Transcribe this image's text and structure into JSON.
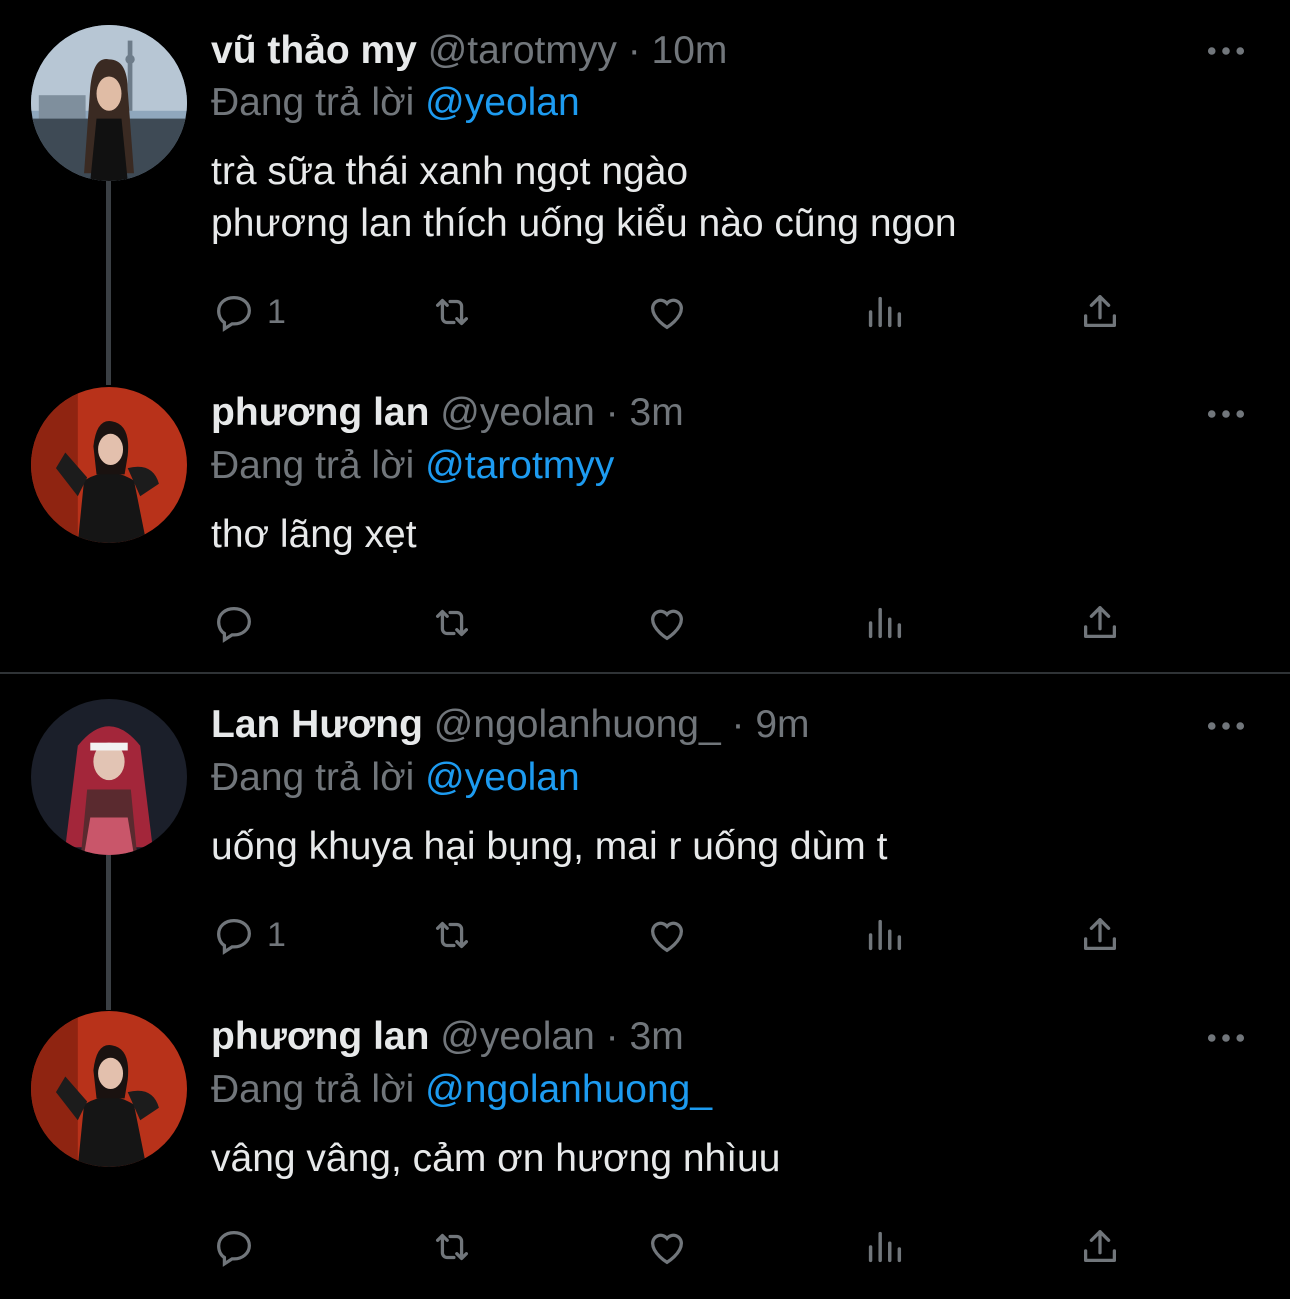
{
  "tweets": [
    {
      "name": "vũ thảo my",
      "handle": "@tarotmyy",
      "sep": "·",
      "time": "10m",
      "reply_prefix": "Đang trả lời",
      "reply_to": "@yeolan",
      "text": "trà sữa thái xanh ngọt ngào\nphương lan thích uống kiểu nào cũng ngon",
      "reply_count": "1"
    },
    {
      "name": "phương lan",
      "handle": "@yeolan",
      "sep": "·",
      "time": "3m",
      "reply_prefix": "Đang trả lời",
      "reply_to": "@tarotmyy",
      "text": "thơ lãng xẹt",
      "reply_count": ""
    },
    {
      "name": "Lan Hương",
      "handle": "@ngolanhuong_",
      "sep": "·",
      "time": "9m",
      "reply_prefix": "Đang trả lời",
      "reply_to": "@yeolan",
      "text": "uống khuya hại bụng, mai r uống dùm t",
      "reply_count": "1"
    },
    {
      "name": "phương lan",
      "handle": "@yeolan",
      "sep": "·",
      "time": "3m",
      "reply_prefix": "Đang trả lời",
      "reply_to": "@ngolanhuong_",
      "text": "vâng vâng, cảm ơn hương nhìuu",
      "reply_count": ""
    }
  ],
  "icons": {
    "reply": "speech-bubble-icon",
    "retweet": "retweet-icon",
    "like": "heart-icon",
    "views": "bar-chart-icon",
    "share": "share-upload-icon",
    "more": "more-horizontal-icon"
  },
  "colors": {
    "background": "#000000",
    "text": "#e7e9ea",
    "muted": "#71767b",
    "mention": "#1d9bf0",
    "divider": "#2f3336",
    "thread_line": "#3a3f44"
  }
}
